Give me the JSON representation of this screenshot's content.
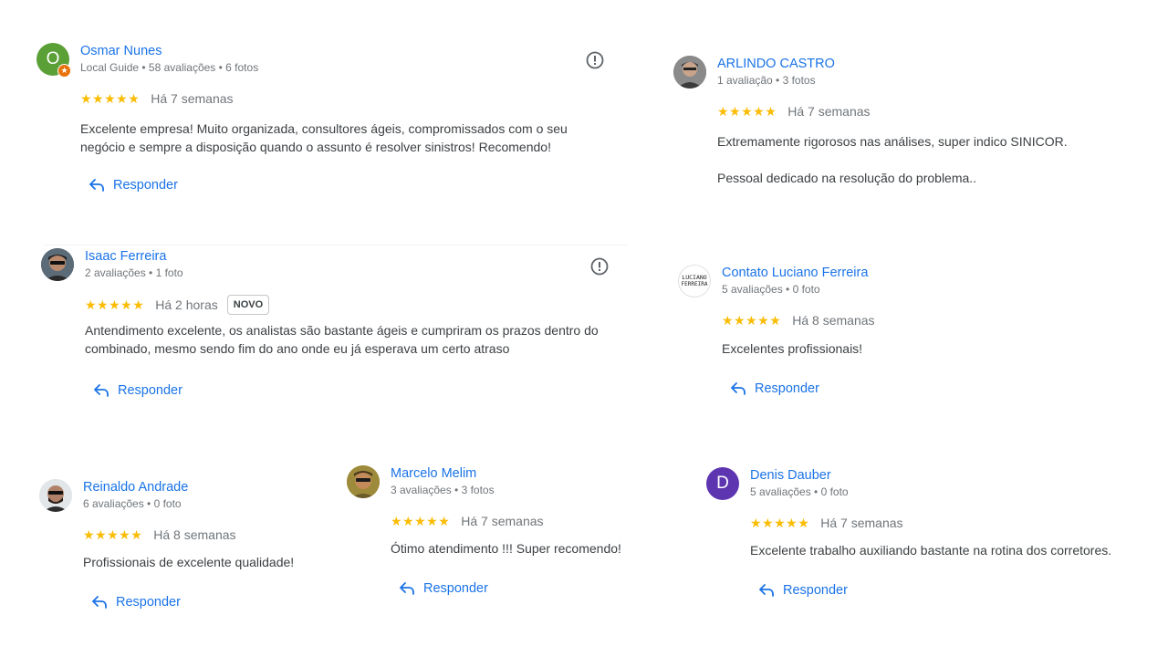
{
  "colors": {
    "accent": "#1a73e8",
    "star": "#fbbc04",
    "muted": "#70757a",
    "text": "#3c4043"
  },
  "reviews": [
    {
      "name": "Osmar Nunes",
      "meta": "Local Guide • 58 avaliações • 6 fotos",
      "stars": "★★★★★",
      "time": "Há 7 semanas",
      "paragraphs": [
        "Excelente empresa! Muito organizada, consultores ágeis, compromissados com o seu negócio e sempre a disposição quando o assunto é resolver sinistros! Recomendo!"
      ],
      "reply": "Responder",
      "avatar_letter": "O",
      "avatar_color": "#5ba037",
      "badge_icon": "local-guide-star-icon"
    },
    {
      "name": "ARLINDO CASTRO",
      "meta": "1 avaliação • 3 fotos",
      "stars": "★★★★★",
      "time": "Há 7 semanas",
      "paragraphs": [
        "Extremamente rigorosos nas análises, super indico SINICOR.",
        "Pessoal dedicado na resolução do problema.."
      ],
      "avatar_icon": "person-photo-icon"
    },
    {
      "name": "Isaac Ferreira",
      "meta": "2 avaliações • 1 foto",
      "stars": "★★★★★",
      "time": "Há 2 horas",
      "badge": "NOVO",
      "paragraphs": [
        "Antendimento excelente, os analistas são bastante ágeis e cumpriram os prazos dentro do combinado, mesmo sendo fim do ano onde eu já esperava um certo atraso"
      ],
      "reply": "Responder",
      "avatar_icon": "person-photo-icon"
    },
    {
      "name": "Contato Luciano Ferreira",
      "meta": "5 avaliações • 0 foto",
      "stars": "★★★★★",
      "time": "Há 8 semanas",
      "paragraphs": [
        "Excelentes profissionais!"
      ],
      "reply": "Responder",
      "avatar_logo_text": [
        "LUCIANO",
        "FERREIRA"
      ]
    },
    {
      "name": "Reinaldo Andrade",
      "meta": "6 avaliações • 0 foto",
      "stars": "★★★★★",
      "time": "Há 8 semanas",
      "paragraphs": [
        "Profissionais de excelente qualidade!"
      ],
      "reply": "Responder",
      "avatar_icon": "person-photo-icon"
    },
    {
      "name": "Marcelo Melim",
      "meta": "3 avaliações • 3 fotos",
      "stars": "★★★★★",
      "time": "Há 7 semanas",
      "paragraphs": [
        "Ótimo atendimento !!! Super recomendo!"
      ],
      "reply": "Responder",
      "avatar_icon": "person-photo-icon"
    },
    {
      "name": "Denis Dauber",
      "meta": "5 avaliações • 0 foto",
      "stars": "★★★★★",
      "time": "Há 7 semanas",
      "paragraphs": [
        "Excelente trabalho auxiliando bastante na rotina dos corretores."
      ],
      "reply": "Responder",
      "avatar_letter": "D",
      "avatar_color": "#5e35b1"
    }
  ]
}
